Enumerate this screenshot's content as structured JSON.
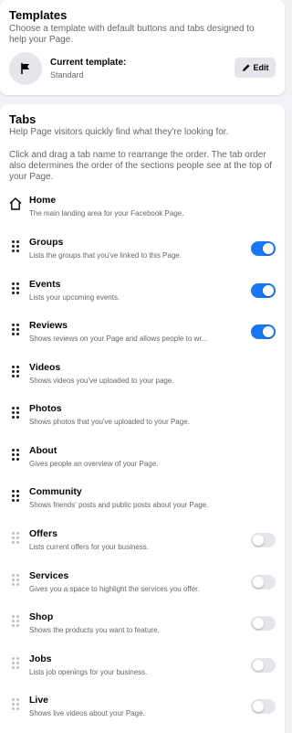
{
  "templates": {
    "title": "Templates",
    "description": "Choose a template with default buttons and tabs designed to help your Page.",
    "current_label": "Current template:",
    "current_value": "Standard",
    "edit_label": "Edit",
    "icon": "flag-icon"
  },
  "tabs": {
    "title": "Tabs",
    "intro": "Help Page visitors quickly find what they're looking for.",
    "instructions": "Click and drag a tab name to rearrange the order. The tab order also determines the order of the sections people see at the top of your Page.",
    "items": [
      {
        "name": "Home",
        "desc": "The main landing area for your Facebook Page.",
        "icon": "home-icon",
        "toggle": null
      },
      {
        "name": "Groups",
        "desc": "Lists the groups that you've linked to this Page.",
        "icon": "drag-handle-icon",
        "toggle": true
      },
      {
        "name": "Events",
        "desc": "Lists your upcoming events.",
        "icon": "drag-handle-icon",
        "toggle": true
      },
      {
        "name": "Reviews",
        "desc": "Shows reviews on your Page and allows people to wr...",
        "icon": "drag-handle-icon",
        "toggle": true
      },
      {
        "name": "Videos",
        "desc": "Shows videos you've uploaded to your page.",
        "icon": "drag-handle-icon",
        "toggle": null
      },
      {
        "name": "Photos",
        "desc": "Shows photos that you've uploaded to your Page.",
        "icon": "drag-handle-icon",
        "toggle": null
      },
      {
        "name": "About",
        "desc": "Gives people an overview of your Page.",
        "icon": "drag-handle-icon",
        "toggle": null
      },
      {
        "name": "Community",
        "desc": "Shows friends' posts and public posts about your Page.",
        "icon": "drag-handle-icon",
        "toggle": null
      },
      {
        "name": "Offers",
        "desc": "Lists current offers for your business.",
        "icon": "drag-handle-icon",
        "toggle": false
      },
      {
        "name": "Services",
        "desc": "Gives you a space to highlight the services you offer.",
        "icon": "drag-handle-icon",
        "toggle": false
      },
      {
        "name": "Shop",
        "desc": "Shows the products you want to feature.",
        "icon": "drag-handle-icon",
        "toggle": false
      },
      {
        "name": "Jobs",
        "desc": "Lists job openings for your business.",
        "icon": "drag-handle-icon",
        "toggle": false
      },
      {
        "name": "Live",
        "desc": "Shows live videos about your Page.",
        "icon": "drag-handle-icon",
        "toggle": false
      }
    ]
  },
  "colors": {
    "accent": "#1877f2",
    "toggle_off": "#e4e6eb",
    "secondary_text": "#65676b"
  }
}
